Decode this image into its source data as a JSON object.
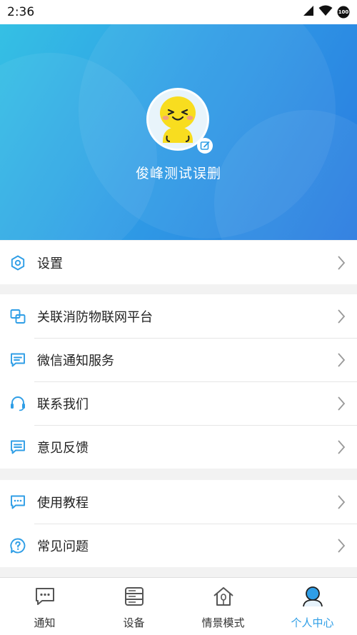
{
  "status_bar": {
    "time": "2:36",
    "battery": "100"
  },
  "profile": {
    "username": "俊峰测试误删"
  },
  "menu_groups": [
    [
      {
        "label": "设置",
        "icon": "gear-icon"
      }
    ],
    [
      {
        "label": "关联消防物联网平台",
        "icon": "link-icon"
      },
      {
        "label": "微信通知服务",
        "icon": "message-icon"
      },
      {
        "label": "联系我们",
        "icon": "headset-icon"
      },
      {
        "label": "意见反馈",
        "icon": "feedback-icon"
      }
    ],
    [
      {
        "label": "使用教程",
        "icon": "tutorial-icon"
      },
      {
        "label": "常见问题",
        "icon": "question-icon"
      }
    ]
  ],
  "tabs": [
    {
      "label": "通知",
      "icon": "chat-icon"
    },
    {
      "label": "设备",
      "icon": "server-icon"
    },
    {
      "label": "情景模式",
      "icon": "home-icon"
    },
    {
      "label": "个人中心",
      "icon": "person-icon",
      "active": true
    }
  ],
  "colors": {
    "accent": "#2f9ee6",
    "header_start": "#35c0e4",
    "header_end": "#2a7be0"
  }
}
